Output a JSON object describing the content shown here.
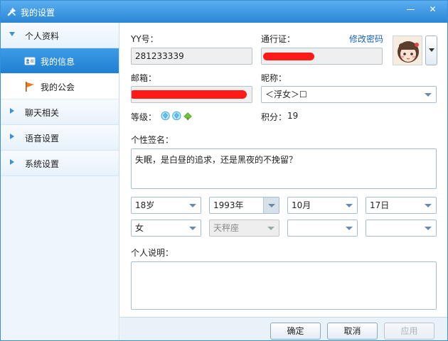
{
  "window": {
    "title": "我的设置",
    "minimize_glyph": "—",
    "close_glyph": "✕"
  },
  "sidebar": {
    "groups": [
      {
        "label": "个人资料",
        "expanded": true
      },
      {
        "label": "聊天相关",
        "expanded": false
      },
      {
        "label": "语音设置",
        "expanded": false
      },
      {
        "label": "系统设置",
        "expanded": false
      }
    ],
    "subitems": [
      {
        "label": "我的信息",
        "icon": "id-card-icon",
        "active": true
      },
      {
        "label": "我的公会",
        "icon": "flag-icon",
        "active": false
      }
    ]
  },
  "profile": {
    "yy_label": "YY号：",
    "yy_value": "281233339",
    "passport_label": "通行证：",
    "change_password_link": "修改密码",
    "email_label": "邮箱：",
    "nickname_label": "昵称：",
    "nickname_value": "＜浮女＞☐",
    "level_label": "等级：",
    "points_label": "积分：",
    "points_value": "19",
    "signature_label": "个性签名：",
    "signature_value": "失眠，是白昼的追求，还是黑夜的不挽留？",
    "age": "18岁",
    "birth_year": "1993年",
    "birth_month": "10月",
    "birth_day": "17日",
    "gender": "女",
    "zodiac": "天秤座",
    "region1": "",
    "region2": "",
    "description_label": "个人说明：",
    "description_value": ""
  },
  "footer": {
    "ok": "确定",
    "cancel": "取消",
    "apply": "应用"
  },
  "colors": {
    "accent": "#2b86d6",
    "redaction": "#ff1a1a",
    "link": "#1a62b5"
  }
}
